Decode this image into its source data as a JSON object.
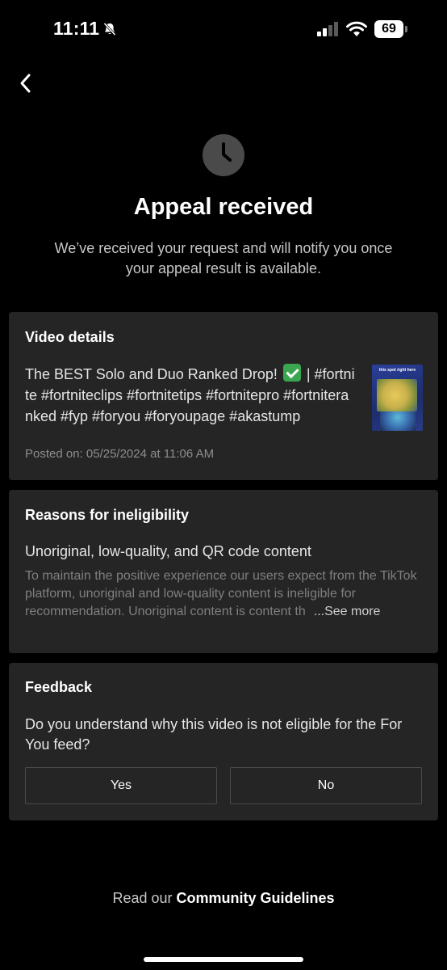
{
  "status_bar": {
    "time": "11:11",
    "battery": "69"
  },
  "header": {
    "back_icon": "chevron-left-icon",
    "status_icon": "clock-icon",
    "title": "Appeal received",
    "subtitle": "We’ve received your request and will notify you once your appeal result is available."
  },
  "video_details": {
    "heading": "Video details",
    "description_before_emoji": "The BEST Solo and Duo Ranked Drop! ",
    "description_after_emoji": " | #fortnite #fortniteclips #fortnitetips #fortnitepro #fortniteranked #fyp #foryou #foryoupage #akastump",
    "thumbnail_caption": "this spot right here",
    "posted": "Posted on: 05/25/2024 at 11:06 AM"
  },
  "reasons": {
    "heading": "Reasons for ineligibility",
    "title": "Unoriginal, low-quality, and QR code content",
    "body": "To maintain the positive experience our users expect from the TikTok platform, unoriginal and low-quality content is ineligible for recommendation. Unoriginal content is content th",
    "see_more": "...See more"
  },
  "feedback": {
    "heading": "Feedback",
    "question": "Do you understand why this video is not eligible for the For You feed?",
    "yes_label": "Yes",
    "no_label": "No"
  },
  "footer": {
    "prefix": "Read our ",
    "link": "Community Guidelines"
  },
  "colors": {
    "background": "#000000",
    "card": "#252525",
    "muted_text": "#7f7f7f",
    "icon_badge": "#4a4a4a"
  }
}
